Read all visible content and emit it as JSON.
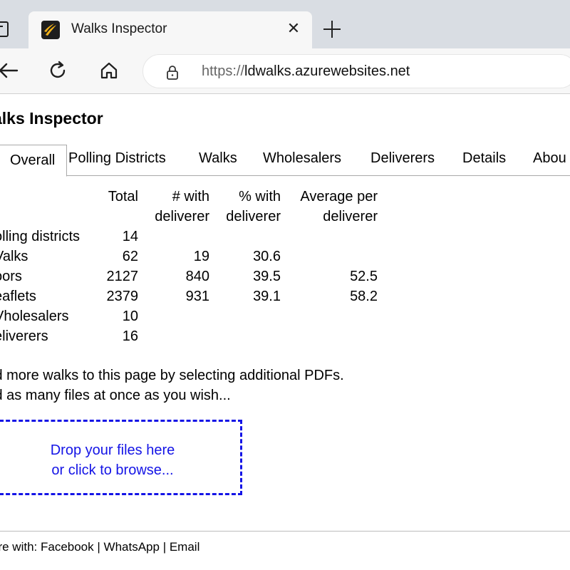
{
  "browser": {
    "tab_title": "Walks Inspector",
    "tab_close": "✕",
    "url_scheme": "https://",
    "url_host": "ldwalks.azurewebsites.net"
  },
  "page": {
    "title": "alks Inspector"
  },
  "tabs": [
    {
      "label": "Overall",
      "active": true
    },
    {
      "label": "Polling Districts"
    },
    {
      "label": "Walks"
    },
    {
      "label": "Wholesalers"
    },
    {
      "label": "Deliverers"
    },
    {
      "label": "Details"
    },
    {
      "label": "Abou"
    }
  ],
  "stats": {
    "headers": {
      "total": "Total",
      "with_line1": "# with",
      "with_line2": "deliverer",
      "pct_line1": "% with",
      "pct_line2": "deliverer",
      "avg_line1": "Average per",
      "avg_line2": "deliverer"
    },
    "rows": [
      {
        "label": "olling districts",
        "total": "14",
        "with": "",
        "pct": "",
        "avg": ""
      },
      {
        "label": "Valks",
        "total": "62",
        "with": "19",
        "pct": "30.6",
        "avg": ""
      },
      {
        "label": "oors",
        "total": "2127",
        "with": "840",
        "pct": "39.5",
        "avg": "52.5"
      },
      {
        "label": "eaflets",
        "total": "2379",
        "with": "931",
        "pct": "39.1",
        "avg": "58.2"
      },
      {
        "label": "Vholesalers",
        "total": "10",
        "with": "",
        "pct": "",
        "avg": ""
      },
      {
        "label": "eliverers",
        "total": "16",
        "with": "",
        "pct": "",
        "avg": ""
      }
    ]
  },
  "help": {
    "line1": "ld more walks to this page by selecting additional PDFs.",
    "line2": "ld as many files at once as you wish..."
  },
  "dropzone": {
    "line1": "Drop your files here",
    "line2": "or click to browse..."
  },
  "footer": {
    "prefix": "are with: ",
    "facebook": "Facebook",
    "sep": " | ",
    "whatsapp": "WhatsApp",
    "email": "Email"
  },
  "colors": {
    "link_blue": "#1414e6",
    "chrome_bg": "#d9dde3",
    "toolbar_bg": "#f7f7f7"
  }
}
